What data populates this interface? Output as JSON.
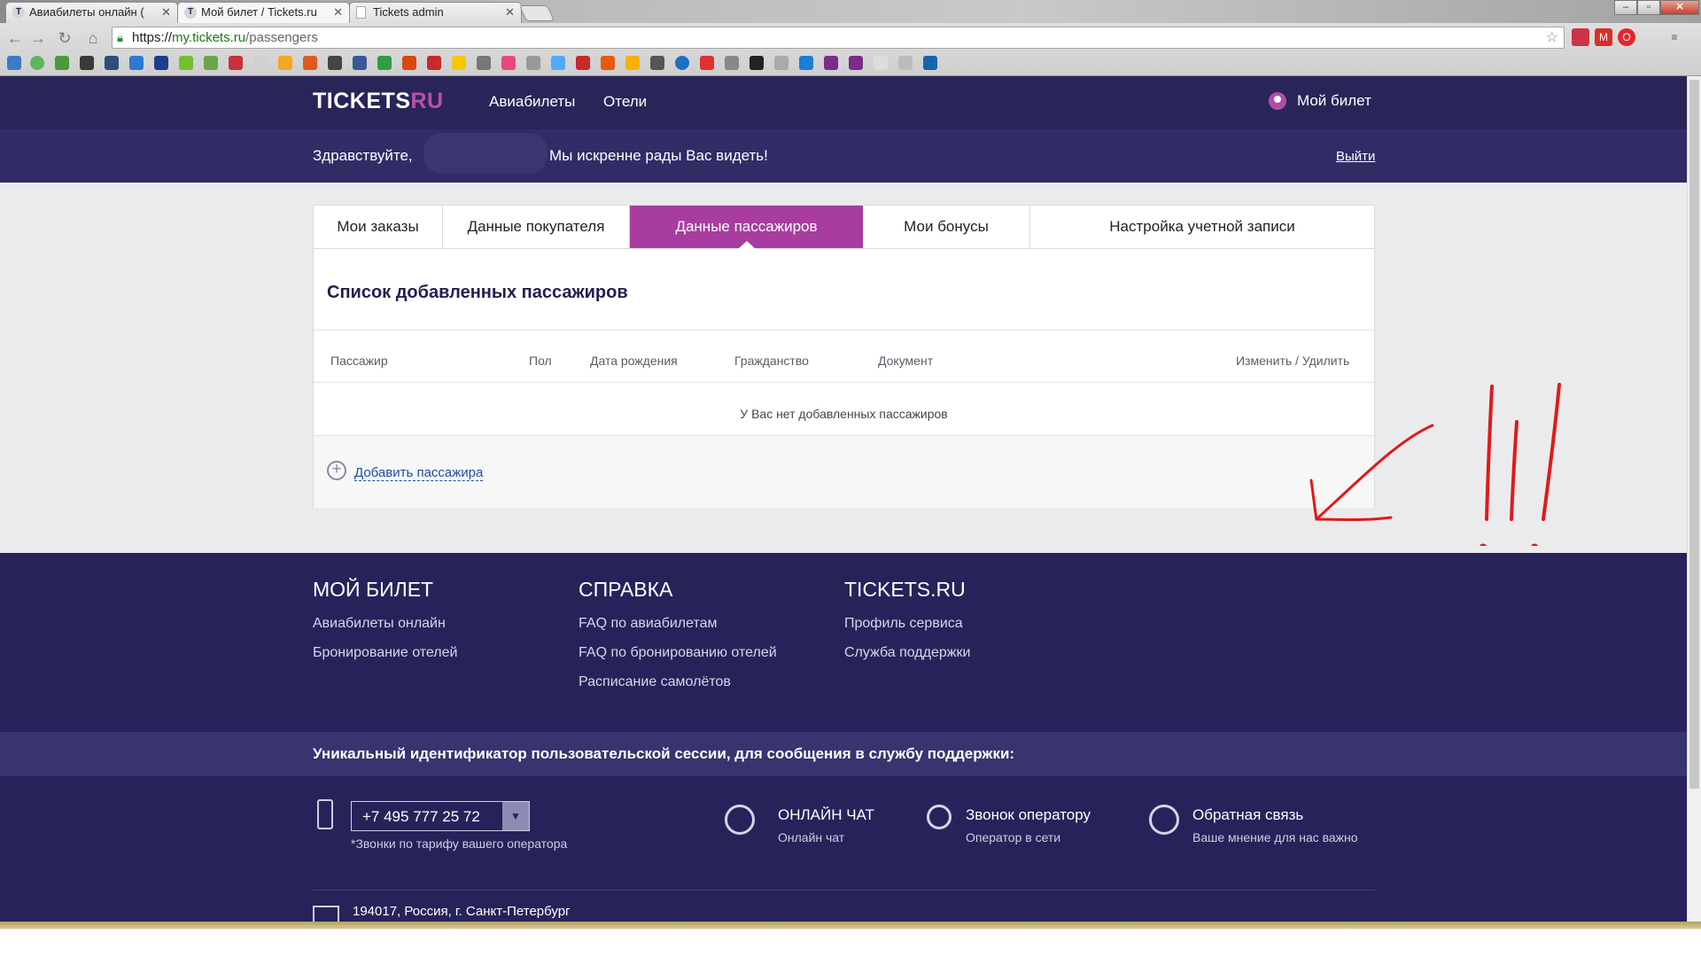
{
  "browser": {
    "tabs": [
      {
        "title": "Авиабилеты онлайн (",
        "icon": "tickets-favicon"
      },
      {
        "title": "Мой билет / Tickets.ru",
        "icon": "tickets-favicon"
      },
      {
        "title": "Tickets admin",
        "icon": "document-icon"
      }
    ],
    "url_scheme": "https://",
    "url_host": "my.tickets.ru",
    "url_path": "/passengers"
  },
  "header": {
    "logo_main": "TICKETS",
    "logo_accent": "RU",
    "nav": [
      "Авиабилеты",
      "Отели"
    ],
    "account_label": "Мой билет"
  },
  "welcome": {
    "greeting": "Здравствуйте,",
    "message": "Мы искренне рады Вас видеть!",
    "logout": "Выйти"
  },
  "profile_tabs": [
    "Мои заказы",
    "Данные покупателя",
    "Данные пассажиров",
    "Мои бонусы",
    "Настройка учетной записи"
  ],
  "active_tab": "Данные пассажиров",
  "passengers": {
    "title": "Список добавленных пассажиров",
    "columns": [
      "Пассажир",
      "Пол",
      "Дата рождения",
      "Гражданство",
      "Документ",
      "Изменить / Удилить"
    ],
    "empty_message": "У Вас нет добавленных пассажиров",
    "add_label": "Добавить пассажира"
  },
  "footer": {
    "columns": [
      {
        "title": "МОЙ БИЛЕТ",
        "links": [
          "Авиабилеты онлайн",
          "Бронирование отелей"
        ]
      },
      {
        "title": "СПРАВКА",
        "links": [
          "FAQ по авиабилетам",
          "FAQ по бронированию отелей",
          "Расписание самолётов"
        ]
      },
      {
        "title": "TICKETS.RU",
        "links": [
          "Профиль сервиса",
          "Служба поддержки"
        ]
      }
    ],
    "session_text": "Уникальный идентификатор пользовательской сессии, для сообщения в службу поддержки:",
    "phone": "+7 495 777 25 72",
    "phone_note": "*Звонки по тарифу вашего оператора",
    "services": [
      {
        "title": "ОНЛАЙН ЧАТ",
        "subtitle": "Онлайн чат"
      },
      {
        "title": "Звонок оператору",
        "subtitle": "Оператор в сети"
      },
      {
        "title": "Обратная связь",
        "subtitle": "Ваше мнение для нас важно"
      }
    ],
    "address": "194017, Россия, г. Санкт-Петербург"
  },
  "colors": {
    "header_bg": "#2a2558",
    "active_tab": "#a83d9f",
    "footer_bg": "#27235a",
    "annotation": "#e01a1a"
  }
}
